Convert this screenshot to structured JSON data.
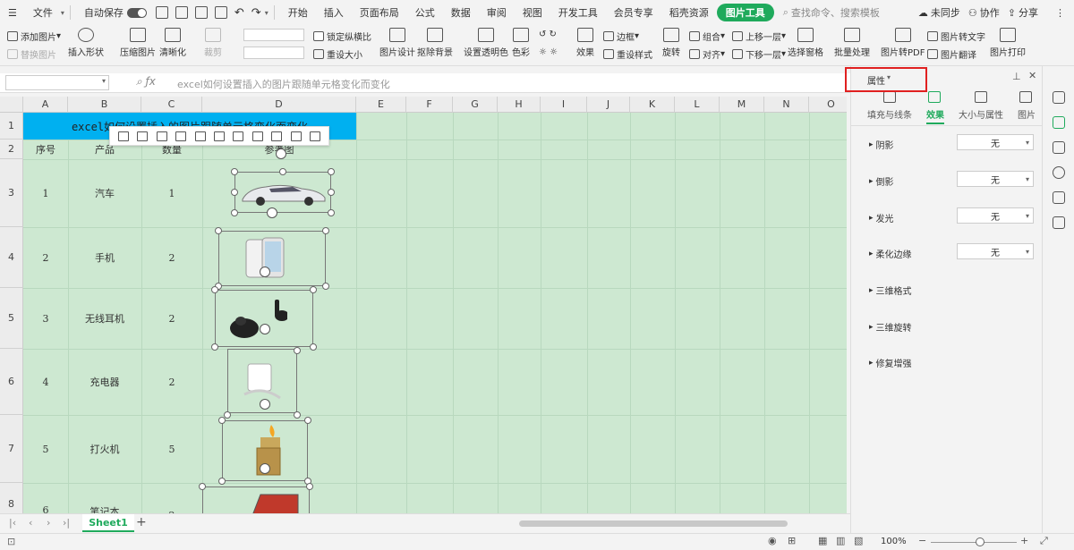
{
  "menubar": {
    "file": "文件",
    "autosave": "自动保存",
    "tabs": [
      "开始",
      "插入",
      "页面布局",
      "公式",
      "数据",
      "审阅",
      "视图",
      "开发工具",
      "会员专享",
      "稻壳资源",
      "图片工具"
    ],
    "active_tab": "图片工具",
    "search_placeholder": "查找命令、搜索模板",
    "sync": "未同步",
    "collab": "协作",
    "share": "分享"
  },
  "ribbon": {
    "add_image": "添加图片",
    "replace_image": "替换图片",
    "insert_shape": "插入形状",
    "compress_image": "压缩图片",
    "sharpen": "清晰化",
    "crop": "裁剪",
    "lock_ratio": "锁定纵横比",
    "reset_size": "重设大小",
    "image_design": "图片设计",
    "remove_bg": "抠除背景",
    "set_transparent": "设置透明色",
    "color": "色彩",
    "border": "边框",
    "effects": "效果",
    "reset_style": "重设样式",
    "rotate": "旋转",
    "group": "组合",
    "align": "对齐",
    "bring_forward": "上移一层",
    "send_backward": "下移一层",
    "selection_pane": "选择窗格",
    "batch": "批量处理",
    "img_to_pdf": "图片转PDF",
    "img_to_text": "图片转文字",
    "img_translate": "图片翻译",
    "img_print": "图片打印"
  },
  "formula": {
    "value": "excel如何设置插入的图片跟随单元格变化而变化"
  },
  "grid": {
    "columns": [
      "A",
      "B",
      "C",
      "D",
      "E",
      "F",
      "G",
      "H",
      "I",
      "J",
      "K",
      "L",
      "M",
      "N",
      "O"
    ],
    "rows": [
      "1",
      "2",
      "3",
      "4",
      "5",
      "6",
      "7"
    ],
    "title": "excel如何设置插入的图片跟随单元格变化而变化",
    "headers": [
      "序号",
      "产品",
      "数量",
      "参考图"
    ],
    "data": [
      {
        "no": "1",
        "product": "汽车",
        "qty": "1"
      },
      {
        "no": "2",
        "product": "手机",
        "qty": "2"
      },
      {
        "no": "3",
        "product": "无线耳机",
        "qty": "2"
      },
      {
        "no": "4",
        "product": "充电器",
        "qty": "2"
      },
      {
        "no": "5",
        "product": "打火机",
        "qty": "5"
      },
      {
        "no": "6",
        "product": "笔记本",
        "qty": "2"
      }
    ]
  },
  "sheets": {
    "active": "Sheet1"
  },
  "status": {
    "zoom": "100%"
  },
  "panel": {
    "title": "属性",
    "tabs": [
      "填充与线条",
      "效果",
      "大小与属性",
      "图片"
    ],
    "active_tab": "效果",
    "props": [
      {
        "label": "阴影",
        "value": "无"
      },
      {
        "label": "倒影",
        "value": "无"
      },
      {
        "label": "发光",
        "value": "无"
      },
      {
        "label": "柔化边缘",
        "value": "无"
      },
      {
        "label": "三维格式",
        "value": ""
      },
      {
        "label": "三维旋转",
        "value": ""
      },
      {
        "label": "修复增强",
        "value": ""
      }
    ]
  },
  "colors": {
    "accent": "#1faa5c",
    "title_fill": "#00b0f0",
    "grid_bg": "#cde8d1",
    "highlight": "#e02020"
  }
}
